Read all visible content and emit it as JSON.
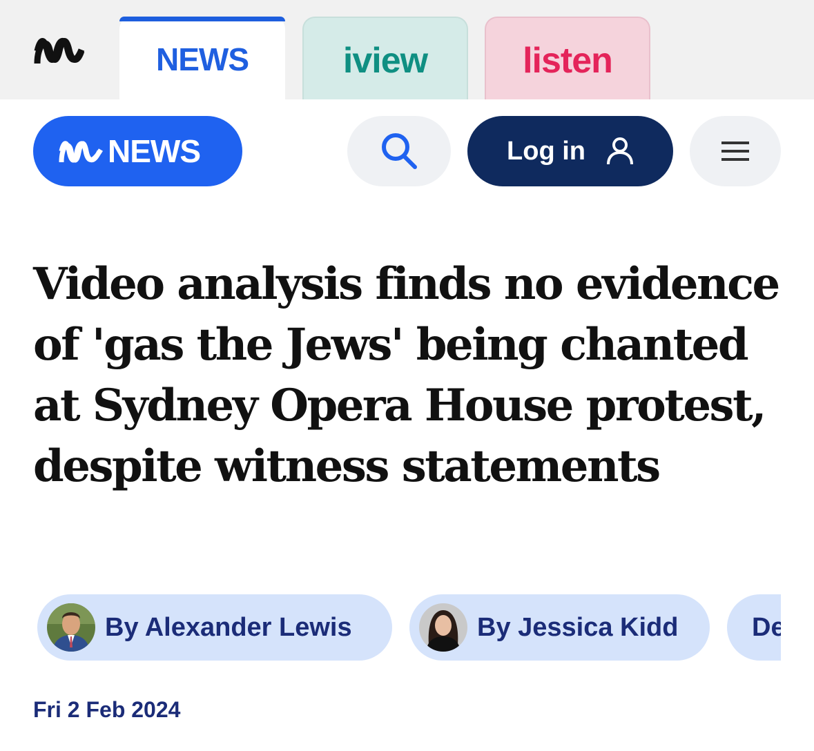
{
  "network_bar": {
    "logo": "abc-logo",
    "tabs": [
      {
        "label": "NEWS",
        "active": true,
        "color": "#1f5fe0"
      },
      {
        "label": "iview",
        "active": false,
        "color": "#0f8f82"
      },
      {
        "label": "listen",
        "active": false,
        "color": "#e4245a"
      }
    ]
  },
  "header": {
    "brand_label": "NEWS",
    "brand_color": "#1f62f0",
    "search_icon": "search-icon",
    "login_label": "Log in",
    "login_icon": "user-icon",
    "menu_icon": "hamburger-menu-icon"
  },
  "article": {
    "headline": "Video analysis finds no evidence of 'gas the Jews' being chanted at Sydney Opera House protest, despite witness statements",
    "authors": [
      {
        "label": "By Alexander Lewis"
      },
      {
        "label": "By Jessica Kidd"
      },
      {
        "label": "De"
      }
    ],
    "date": "Fri 2 Feb 2024"
  }
}
